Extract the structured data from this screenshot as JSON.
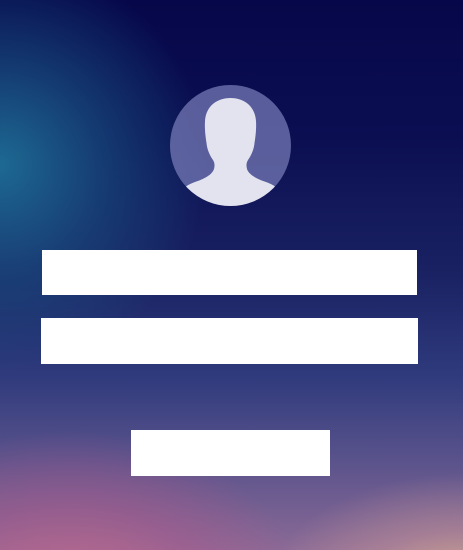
{
  "avatar": {
    "icon": "user-silhouette-icon"
  },
  "form": {
    "username": {
      "value": "",
      "placeholder": ""
    },
    "password": {
      "value": "",
      "placeholder": ""
    },
    "submit_label": ""
  },
  "colors": {
    "background_top": "#06074a",
    "background_bottom_left": "#c86e8c",
    "background_bottom_right": "#e6be8c",
    "field_background": "#ffffff"
  }
}
